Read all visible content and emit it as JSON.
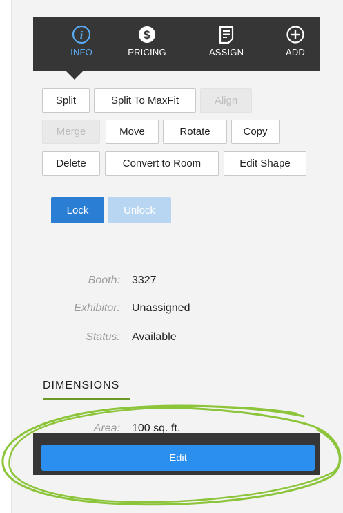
{
  "tabs": [
    {
      "label": "INFO",
      "icon": "info-icon",
      "active": true
    },
    {
      "label": "PRICING",
      "icon": "dollar-icon",
      "active": false
    },
    {
      "label": "ASSIGN",
      "icon": "document-icon",
      "active": false
    },
    {
      "label": "ADD",
      "icon": "plus-circle-icon",
      "active": false
    }
  ],
  "actions": {
    "split": "Split",
    "split_to_maxfit": "Split To MaxFit",
    "align": "Align",
    "merge": "Merge",
    "move": "Move",
    "rotate": "Rotate",
    "copy": "Copy",
    "delete": "Delete",
    "convert_to_room": "Convert to Room",
    "edit_shape": "Edit Shape"
  },
  "lock": {
    "lock_label": "Lock",
    "unlock_label": "Unlock"
  },
  "info": {
    "booth_label": "Booth:",
    "booth_value": "3327",
    "exhibitor_label": "Exhibitor:",
    "exhibitor_value": "Unassigned",
    "status_label": "Status:",
    "status_value": "Available"
  },
  "dimensions": {
    "title": "DIMENSIONS",
    "area_label": "Area:",
    "area_value": "100 sq. ft."
  },
  "footer": {
    "edit_label": "Edit"
  },
  "colors": {
    "dark_bar": "#363636",
    "active_tab": "#5aa9f0",
    "primary": "#2a7fd4",
    "edit_button": "#2b8ff0",
    "annotation": "#8cc43a"
  }
}
